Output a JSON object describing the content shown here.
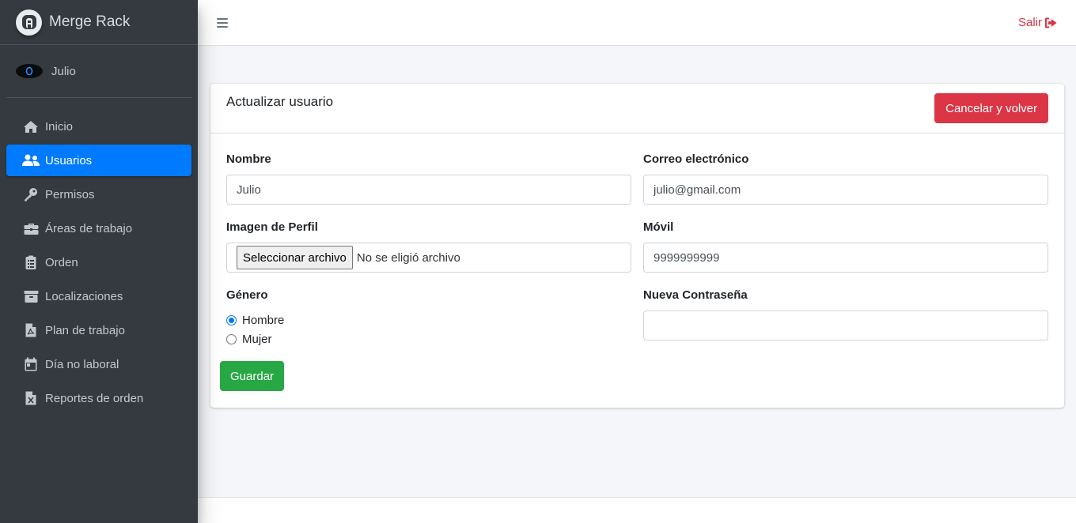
{
  "brand": {
    "name": "Merge Rack"
  },
  "user": {
    "name": "Julio"
  },
  "sidebar": {
    "items": [
      {
        "label": "Inicio",
        "icon": "home-icon",
        "active": false
      },
      {
        "label": "Usuarios",
        "icon": "users-icon",
        "active": true
      },
      {
        "label": "Permisos",
        "icon": "key-icon",
        "active": false
      },
      {
        "label": "Áreas de trabajo",
        "icon": "briefcase-icon",
        "active": false
      },
      {
        "label": "Orden",
        "icon": "clipboard-list-icon",
        "active": false
      },
      {
        "label": "Localizaciones",
        "icon": "archive-icon",
        "active": false
      },
      {
        "label": "Plan de trabajo",
        "icon": "file-pdf-icon",
        "active": false
      },
      {
        "label": "Día no laboral",
        "icon": "calendar-icon",
        "active": false
      },
      {
        "label": "Reportes de orden",
        "icon": "file-excel-icon",
        "active": false
      }
    ]
  },
  "header": {
    "logout_label": "Salir"
  },
  "card": {
    "title": "Actualizar usuario",
    "cancel_label": "Cancelar y volver",
    "save_label": "Guardar"
  },
  "form": {
    "nombre": {
      "label": "Nombre",
      "value": "Julio"
    },
    "correo": {
      "label": "Correo electrónico",
      "value": "julio@gmail.com"
    },
    "imagen": {
      "label": "Imagen de Perfil",
      "button_label": "Seleccionar archivo",
      "status": "No se eligió archivo"
    },
    "movil": {
      "label": "Móvil",
      "value": "9999999999"
    },
    "genero": {
      "label": "Género",
      "options": [
        {
          "label": "Hombre",
          "checked": true
        },
        {
          "label": "Mujer",
          "checked": false
        }
      ]
    },
    "password": {
      "label": "Nueva Contraseña",
      "value": ""
    }
  },
  "colors": {
    "sidebar_bg": "#343a40",
    "active_bg": "#007bff",
    "danger": "#dc3545",
    "success": "#28a745"
  }
}
